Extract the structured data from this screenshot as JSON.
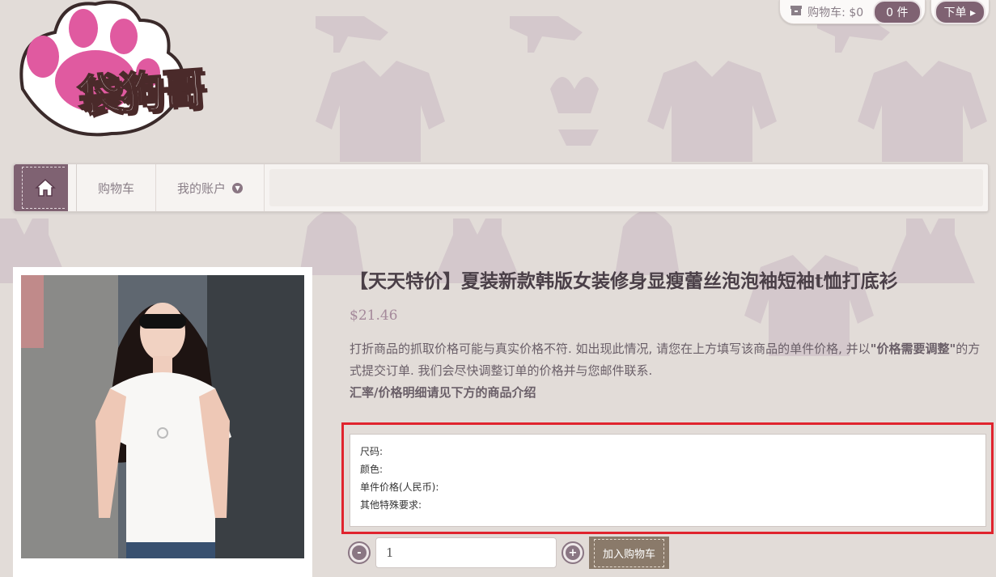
{
  "topbar": {
    "cart_label": "购物车: $0",
    "cart_count": "0 件",
    "order_label": "下单 ▸"
  },
  "logo": {
    "text": "袋狗哥"
  },
  "nav": {
    "items": [
      {
        "label": "购物车"
      },
      {
        "label": "我的账户"
      }
    ]
  },
  "product": {
    "title": "【天天特价】夏装新款韩版女装修身显瘦蕾丝泡泡袖短袖t恤打底衫",
    "price": "$21.46",
    "notice_part1": "打折商品的抓取价格可能与真实价格不符. 如出现此情况, 请您在上方填写该商品的单件价格, 并以",
    "notice_bold": "\"价格需要调整\"",
    "notice_part2": "的方式提交订单. 我们会尽快调整订单的价格并与您邮件联系.",
    "notice_line2": "汇率/价格明细请见下方的商品介绍",
    "options_text": "尺码:\n颜色:\n单件价格(人民币):\n其他特殊要求:",
    "quantity": "1",
    "add_to_cart": "加入购物车"
  }
}
